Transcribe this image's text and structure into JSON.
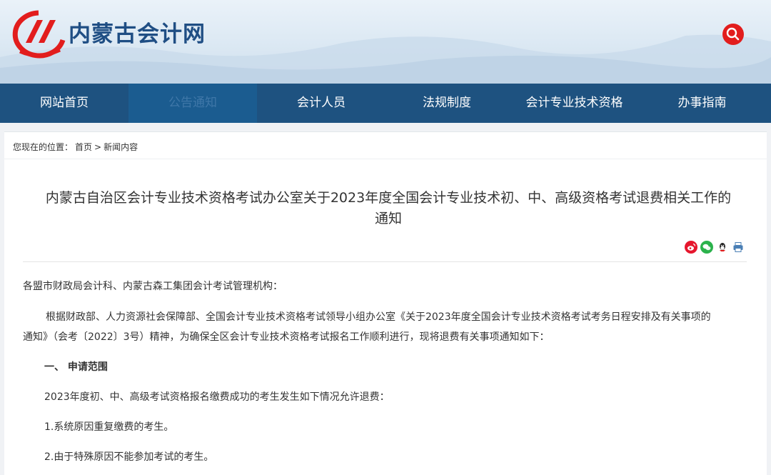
{
  "header": {
    "site_name": "内蒙古会计网",
    "logo_icon": "red-arc-logo-icon",
    "search_icon": "search-icon"
  },
  "nav": {
    "items": [
      {
        "label": "网站首页"
      },
      {
        "label": "公告通知"
      },
      {
        "label": "会计人员"
      },
      {
        "label": "法规制度"
      },
      {
        "label": "会计专业技术资格"
      },
      {
        "label": "办事指南"
      }
    ],
    "active_index": 1
  },
  "breadcrumb": {
    "prefix": "您现在的位置：",
    "home": "首页",
    "separator": ">",
    "current": "新闻内容"
  },
  "article": {
    "title_line1": "内蒙古自治区会计专业技术资格考试办公室关于2023年度全国会计专业技术初、中、高级资格考试退费相关工作的",
    "title_line2": "通知",
    "share_icons": [
      "weibo-icon",
      "wechat-icon",
      "qq-icon",
      "print-icon"
    ],
    "salutation": "各盟市财政局会计科、内蒙古森工集团会计考试管理机构：",
    "body_line1": "根据财政部、人力资源社会保障部、全国会计专业技术资格考试领导小组办公室《关于2023年度全国会计专业技术资格考试考务日程安排及有关事项的",
    "body_line2": "通知》（会考〔2022〕3号）精神，为确保全区会计专业技术资格考试报名工作顺利进行，现将退费有关事项通知如下：",
    "section1_heading": "一、 申请范围",
    "section1_intro": "2023年度初、中、高级考试资格报名缴费成功的考生发生如下情况允许退费：",
    "item1": "1.系统原因重复缴费的考生。",
    "item2": "2.由于特殊原因不能参加考试的考生。"
  },
  "colors": {
    "nav_bg": "#1e5280",
    "brand_blue": "#1f4e84",
    "accent_red": "#e21d1d"
  }
}
